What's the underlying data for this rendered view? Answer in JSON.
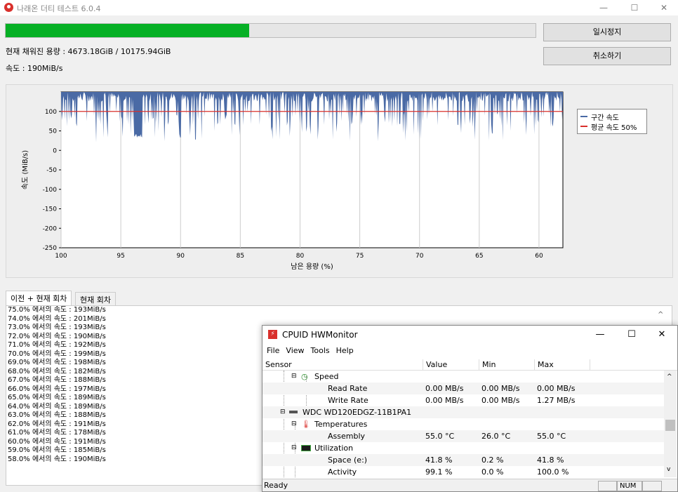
{
  "window": {
    "title": "나래온 더티 테스트 6.0.4",
    "minimize": "—",
    "maximize": "☐",
    "close": "✕"
  },
  "progress": {
    "fraction": 0.459,
    "pause_label": "일시정지",
    "cancel_label": "취소하기",
    "filled_text": "현재 채워진 용량 : 4673.18GiB / 10175.94GiB",
    "speed_text": "속도 : 190MiB/s"
  },
  "chart_data": {
    "type": "area",
    "ylabel": "속도 (MiB/s)",
    "xlabel": "남은 용량 (%)",
    "ylim": [
      -250,
      150
    ],
    "xlim": [
      100,
      58
    ],
    "x_ticks": [
      100,
      95,
      90,
      85,
      80,
      75,
      70,
      65,
      60
    ],
    "y_ticks": [
      100,
      50,
      0,
      -50,
      -100,
      -150,
      -200,
      -250
    ],
    "grid": true,
    "legend_position": "right",
    "series": [
      {
        "name": "구간 속도",
        "color": "#4a6aa5",
        "values_summary": "fluctuating 30–150 MiB/s, mostly 60–150"
      },
      {
        "name": "평균 속도 50%",
        "color": "#d9302c",
        "values": [
          100
        ]
      }
    ]
  },
  "tabs": [
    "이전 + 현재 회차",
    "현재 회차"
  ],
  "log": [
    "75.0% 에서의 속도 : 193MiB/s",
    "74.0% 에서의 속도 : 201MiB/s",
    "73.0% 에서의 속도 : 193MiB/s",
    "72.0% 에서의 속도 : 190MiB/s",
    "71.0% 에서의 속도 : 192MiB/s",
    "70.0% 에서의 속도 : 199MiB/s",
    "69.0% 에서의 속도 : 198MiB/s",
    "68.0% 에서의 속도 : 182MiB/s",
    "67.0% 에서의 속도 : 188MiB/s",
    "66.0% 에서의 속도 : 197MiB/s",
    "65.0% 에서의 속도 : 189MiB/s",
    "64.0% 에서의 속도 : 189MiB/s",
    "63.0% 에서의 속도 : 188MiB/s",
    "62.0% 에서의 속도 : 191MiB/s",
    "61.0% 에서의 속도 : 178MiB/s",
    "60.0% 에서의 속도 : 191MiB/s",
    "59.0% 에서의 속도 : 185MiB/s",
    "58.0% 에서의 속도 : 190MiB/s"
  ],
  "hwmonitor": {
    "title": "CPUID HWMonitor",
    "menu": [
      "File",
      "View",
      "Tools",
      "Help"
    ],
    "columns": [
      "Sensor",
      "Value",
      "Min",
      "Max"
    ],
    "rows": [
      {
        "label": "Speed",
        "value": "",
        "min": "",
        "max": ""
      },
      {
        "label": "Read Rate",
        "value": "0.00 MB/s",
        "min": "0.00 MB/s",
        "max": "0.00 MB/s"
      },
      {
        "label": "Write Rate",
        "value": "0.00 MB/s",
        "min": "0.00 MB/s",
        "max": "1.27 MB/s"
      },
      {
        "label": "WDC WD120EDGZ-11B1PA1",
        "value": "",
        "min": "",
        "max": ""
      },
      {
        "label": "Temperatures",
        "value": "",
        "min": "",
        "max": ""
      },
      {
        "label": "Assembly",
        "value": "55.0 °C",
        "min": "26.0 °C",
        "max": "55.0 °C"
      },
      {
        "label": "Utilization",
        "value": "",
        "min": "",
        "max": ""
      },
      {
        "label": "Space (e:)",
        "value": "41.8 %",
        "min": "0.2 %",
        "max": "41.8 %"
      },
      {
        "label": "Activity",
        "value": "99.1 %",
        "min": "0.0 %",
        "max": "100.0 %"
      }
    ],
    "status": "Ready",
    "num_indicator": "NUM"
  }
}
